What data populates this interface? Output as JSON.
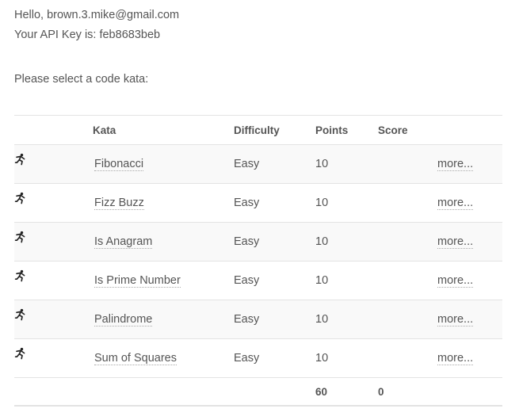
{
  "greeting": {
    "hello_line": "Hello, brown.3.mike@gmail.com",
    "api_key_line": "Your API Key is: feb8683beb"
  },
  "prompt": "Please select a code kata:",
  "table": {
    "headers": {
      "icon": "",
      "kata": "Kata",
      "difficulty": "Difficulty",
      "points": "Points",
      "score": "Score",
      "more": ""
    },
    "rows": [
      {
        "icon": "kata-runner-icon",
        "name": "Fibonacci",
        "difficulty": "Easy",
        "points": "10",
        "score": "",
        "more": "more..."
      },
      {
        "icon": "kata-runner-icon",
        "name": "Fizz Buzz",
        "difficulty": "Easy",
        "points": "10",
        "score": "",
        "more": "more..."
      },
      {
        "icon": "kata-runner-icon",
        "name": "Is Anagram",
        "difficulty": "Easy",
        "points": "10",
        "score": "",
        "more": "more..."
      },
      {
        "icon": "kata-runner-icon",
        "name": "Is Prime Number",
        "difficulty": "Easy",
        "points": "10",
        "score": "",
        "more": "more..."
      },
      {
        "icon": "kata-runner-icon",
        "name": "Palindrome",
        "difficulty": "Easy",
        "points": "10",
        "score": "",
        "more": "more..."
      },
      {
        "icon": "kata-runner-icon",
        "name": "Sum of Squares",
        "difficulty": "Easy",
        "points": "10",
        "score": "",
        "more": "more..."
      }
    ],
    "totals": {
      "points": "60",
      "score": "0"
    }
  },
  "colors": {
    "text": "#555555",
    "row_stripe": "#f9f9f9",
    "border": "#e3e3e3"
  }
}
